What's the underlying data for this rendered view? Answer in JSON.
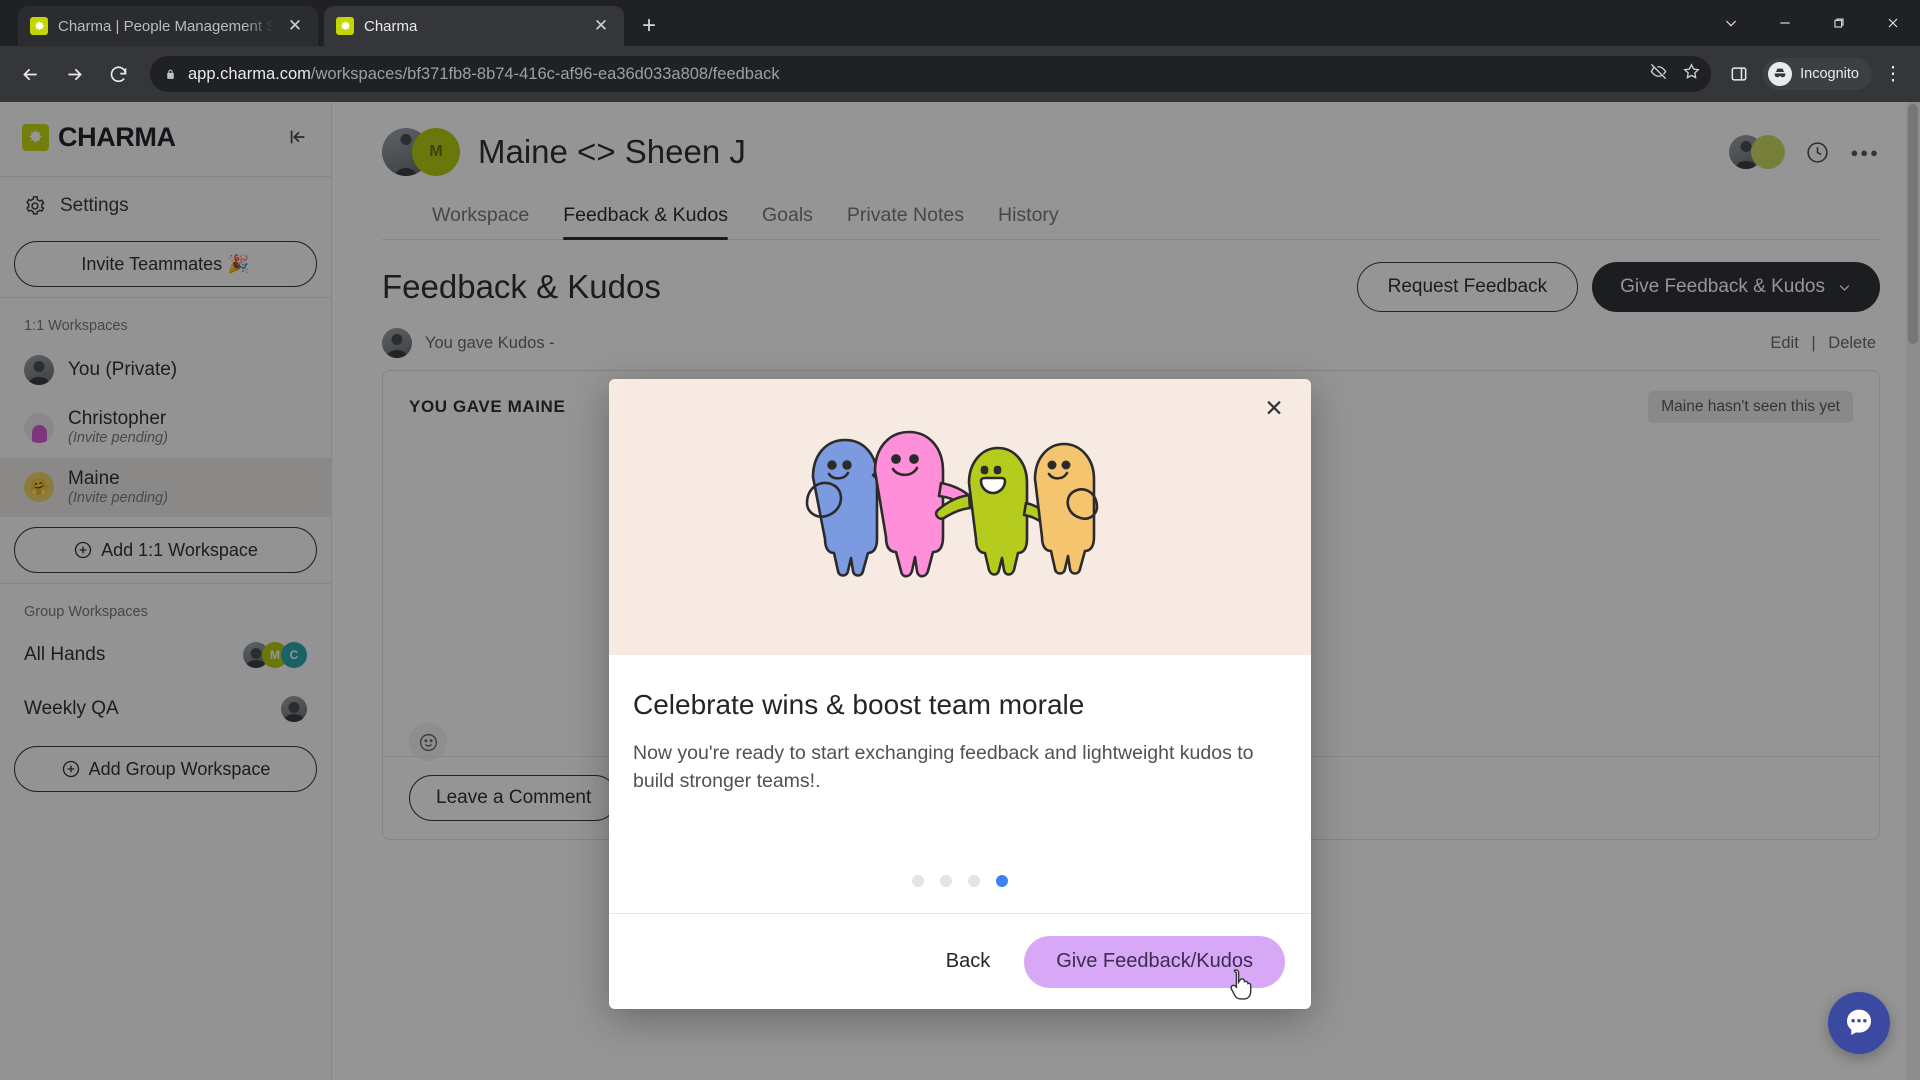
{
  "browser": {
    "tabs": [
      {
        "title": "Charma | People Management S",
        "favicon": "charma-icon",
        "active": false
      },
      {
        "title": "Charma",
        "favicon": "charma-icon",
        "active": true
      }
    ],
    "new_tab_label": "+",
    "url_host": "app.charma.com",
    "url_path": "/workspaces/bf371fb8-8b74-416c-af96-ea36d033a808/feedback",
    "profile_label": "Incognito",
    "window_controls": [
      "chevron-down",
      "minimize",
      "restore",
      "close"
    ]
  },
  "sidebar": {
    "brand": "CHARMA",
    "collapse_icon": "collapse-sidebar-icon",
    "settings_label": "Settings",
    "invite_label": "Invite Teammates 🎉",
    "section_1_1": "1:1 Workspaces",
    "workspaces_1_1": [
      {
        "name": "You (Private)",
        "sub": "",
        "avatar": "person",
        "selected": false
      },
      {
        "name": "Christopher",
        "sub": "(Invite pending)",
        "avatar": "pink",
        "selected": false
      },
      {
        "name": "Maine",
        "sub": "(Invite pending)",
        "avatar": "yellow",
        "selected": true
      }
    ],
    "add_1_1_label": "Add 1:1 Workspace",
    "section_group": "Group Workspaces",
    "group_workspaces": [
      {
        "name": "All Hands",
        "avatars": [
          {
            "type": "person",
            "label": "",
            "color": "#8b9195"
          },
          {
            "type": "letter",
            "label": "M",
            "color": "#b1c900"
          },
          {
            "type": "letter",
            "label": "C",
            "color": "#1fa3a8"
          }
        ]
      },
      {
        "name": "Weekly QA",
        "avatars": [
          {
            "type": "person",
            "label": "",
            "color": "#8b9195"
          }
        ]
      }
    ],
    "add_group_label": "Add Group Workspace"
  },
  "main": {
    "workspace_title": "Maine <> Sheen J",
    "workspace_avatar_letter": "M",
    "header_icons": [
      "history-clock-icon",
      "more-options-icon"
    ],
    "tabs": [
      {
        "label": "Workspace",
        "active": false
      },
      {
        "label": "Feedback & Kudos",
        "active": true
      },
      {
        "label": "Goals",
        "active": false
      },
      {
        "label": "Private Notes",
        "active": false
      },
      {
        "label": "History",
        "active": false
      }
    ],
    "page_title": "Feedback & Kudos",
    "request_feedback_label": "Request Feedback",
    "give_feedback_label": "Give Feedback & Kudos",
    "give_feedback_caret": "chevron-down-icon",
    "feed_meta_text": "You gave Kudos -",
    "edit_label": "Edit",
    "separator": "|",
    "delete_label": "Delete",
    "card_title": "YOU GAVE MAINE",
    "card_badge": "Maine hasn't seen this yet",
    "emoji_icon": "emoji-reaction-icon",
    "comment_label": "Leave a Comment"
  },
  "modal": {
    "close_icon": "close-icon",
    "illustration": "four-blob-characters-illustration",
    "illustration_colors": [
      "#7b9ae0",
      "#ff8fd8",
      "#b5cc1f",
      "#f5c46e"
    ],
    "hero_background": "#f7eae3",
    "heading": "Celebrate wins & boost team morale",
    "body": "Now you're ready to start exchanging feedback and lightweight kudos to build stronger teams!.",
    "dots": {
      "total": 4,
      "active_index": 3,
      "active_color": "#3b82f6",
      "inactive_color": "#e2e4e6"
    },
    "back_label": "Back",
    "primary_label": "Give Feedback/Kudos",
    "primary_color": "#d6a8f5"
  },
  "support": {
    "chat_icon": "intercom-chat-icon",
    "chat_color": "#3b4aa0"
  }
}
